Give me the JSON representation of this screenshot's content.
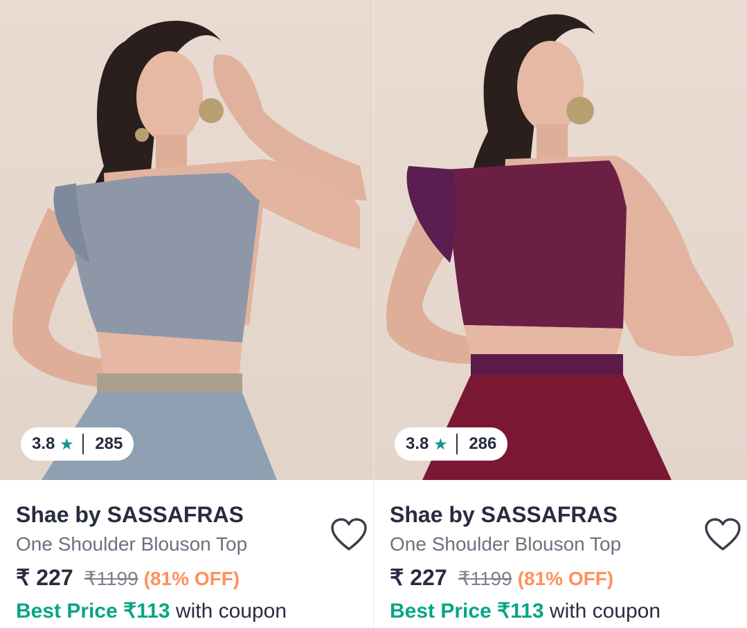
{
  "products": [
    {
      "image_alt": "grey-blue one shoulder top",
      "rating": "3.8",
      "rating_count": "285",
      "brand": "Shae by SASSAFRAS",
      "name": "One Shoulder Blouson Top",
      "price": "₹ 227",
      "mrp": "₹1199",
      "discount": "(81% OFF)",
      "best_price": "Best Price ₹113",
      "coupon_text": " with coupon",
      "top_color": "#8e97a8",
      "skirt_color": "#8fa0b2"
    },
    {
      "image_alt": "maroon purple one shoulder top",
      "rating": "3.8",
      "rating_count": "286",
      "brand": "Shae by SASSAFRAS",
      "name": "One Shoulder Blouson Top",
      "price": "₹ 227",
      "mrp": "₹1199",
      "discount": "(81% OFF)",
      "best_price": "Best Price ₹113",
      "coupon_text": " with coupon",
      "top_color": "#6b1f45",
      "skirt_color": "#7a1833"
    }
  ],
  "icons": {
    "wishlist": "heart-outline-icon",
    "rating": "star-icon"
  },
  "colors": {
    "accent_green": "#03a685",
    "discount_orange": "#ff905a",
    "star_teal": "#14958f"
  }
}
